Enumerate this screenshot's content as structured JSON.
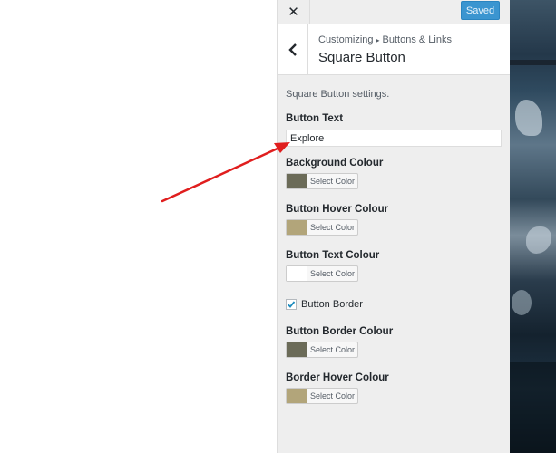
{
  "topbar": {
    "close_icon": "close-icon",
    "saved_label": "Saved"
  },
  "header": {
    "breadcrumb_parent": "Customizing",
    "breadcrumb_child": "Buttons & Links",
    "title": "Square Button"
  },
  "content": {
    "description": "Square Button settings.",
    "button_text": {
      "label": "Button Text",
      "value": "Explore"
    },
    "background_colour": {
      "label": "Background Colour",
      "button": "Select Color",
      "color": "#6b6b58"
    },
    "button_hover_colour": {
      "label": "Button Hover Colour",
      "button": "Select Color",
      "color": "#b2a57a"
    },
    "button_text_colour": {
      "label": "Button Text Colour",
      "button": "Select Color",
      "color": "#ffffff"
    },
    "button_border": {
      "label": "Button Border",
      "checked": true
    },
    "button_border_colour": {
      "label": "Button Border Colour",
      "button": "Select Color",
      "color": "#6b6b58"
    },
    "border_hover_colour": {
      "label": "Border Hover Colour",
      "button": "Select Color",
      "color": "#b2a57a"
    }
  },
  "colors": {
    "accent": "#3b95d0",
    "annotation_arrow": "#e01e1e"
  }
}
